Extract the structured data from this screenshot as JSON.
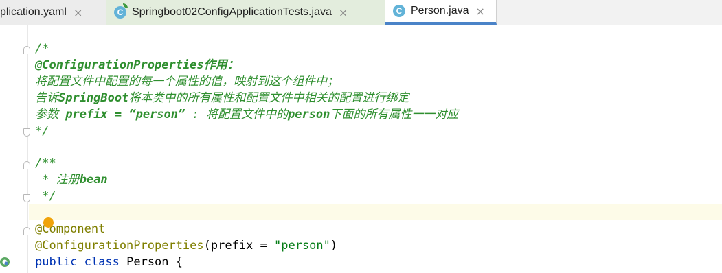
{
  "tabs": [
    {
      "label": "plication.yaml",
      "close": "×"
    },
    {
      "label": "Springboot02ConfigApplicationTests.java",
      "close": "×",
      "icon": "C"
    },
    {
      "label": "Person.java",
      "close": "×",
      "icon": "C",
      "active": true
    }
  ],
  "code": {
    "c1_open": "/*",
    "c1_l1": "@ConfigurationProperties作用：",
    "c1_l2": "将配置文件中配置的每一个属性的值，映射到这个组件中；",
    "c1_l3a": "告诉",
    "c1_l3b": "SpringBoot",
    "c1_l3c": "将本类中的所有属性和配置文件中相关的配置进行绑定",
    "c1_l4a": "参数 ",
    "c1_l4b": "prefix = “person”",
    "c1_l4c": " : 将配置文件中的",
    "c1_l4d": "person",
    "c1_l4e": "下面的所有属性一一对应",
    "c1_close": "*/",
    "c2_open": "/**",
    "c2_l1a": " * 注册",
    "c2_l1b": "bean",
    "c2_close": " */",
    "ann1": "@Component",
    "ann2": "@ConfigurationProperties",
    "ann2_args_a": "(prefix = ",
    "ann2_args_b": "\"person\"",
    "ann2_args_c": ")",
    "kw_public": "public",
    "kw_class": "class",
    "class_name": "Person {"
  },
  "colors": {
    "comment": "#2f8f2f",
    "annotation": "#7f7f00",
    "keyword": "#0033b3",
    "string": "#067d17",
    "active_tab_underline": "#4a83c8"
  }
}
